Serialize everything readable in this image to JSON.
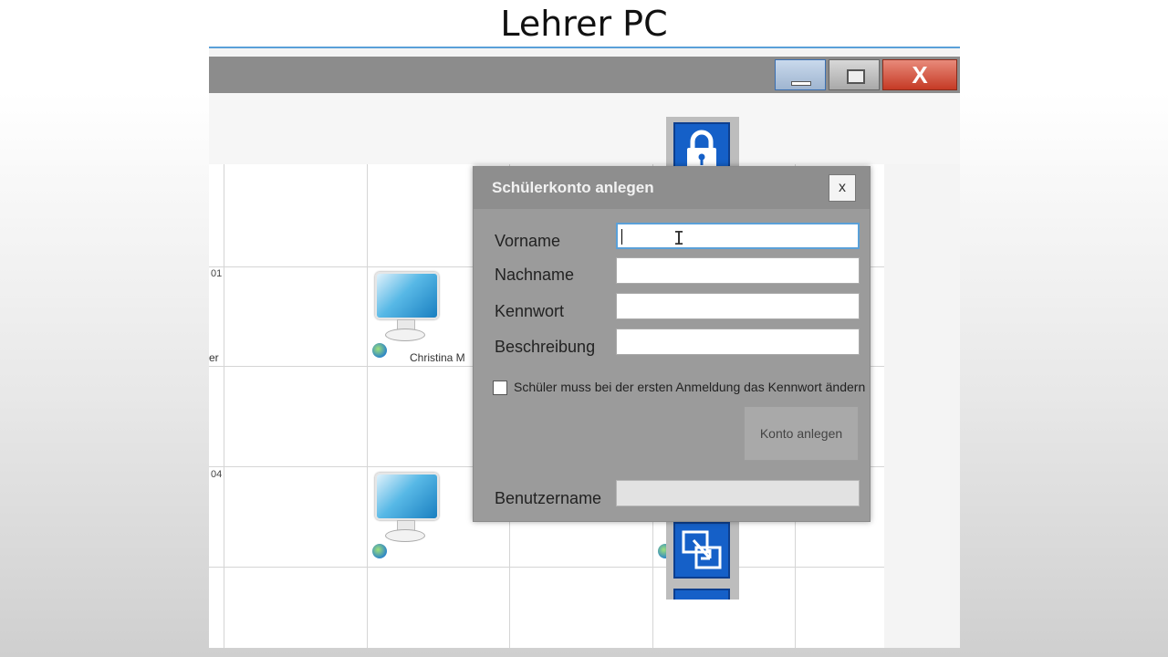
{
  "slide": {
    "title": "Lehrer PC"
  },
  "window": {
    "minimize_label": "",
    "maximize_label": "",
    "close_label": "X"
  },
  "grid": {
    "row_numbers": [
      "01",
      "04"
    ],
    "cell_texts": [
      "er"
    ],
    "computers": [
      {
        "label": "Christina M"
      },
      {
        "label": ""
      },
      {
        "label": ""
      }
    ]
  },
  "dialog": {
    "title": "Schülerkonto anlegen",
    "close_label": "x",
    "fields": {
      "vorname": {
        "label": "Vorname",
        "value": ""
      },
      "nachname": {
        "label": "Nachname",
        "value": ""
      },
      "kennwort": {
        "label": "Kennwort",
        "value": ""
      },
      "beschreibung": {
        "label": "Beschreibung",
        "value": ""
      },
      "benutzername": {
        "label": "Benutzername",
        "value": ""
      }
    },
    "checkbox": {
      "label": "Schüler muss bei der ersten Anmeldung das Kennwort ändern",
      "checked": false
    },
    "submit_label": "Konto anlegen"
  },
  "sidebar": {
    "buttons": [
      {
        "icon": "lock-icon"
      },
      {
        "icon": "briefcase-icon"
      },
      {
        "icon": "internet-explorer-icon"
      },
      {
        "icon": "help-icon"
      },
      {
        "icon": "info-icon"
      },
      {
        "icon": "settings-gear-icon"
      },
      {
        "icon": "switch-window-icon"
      }
    ]
  },
  "colors": {
    "sidebar_button": "#1560c8",
    "dialog_background": "#9b9b9b",
    "close_button": "#c53a25"
  }
}
